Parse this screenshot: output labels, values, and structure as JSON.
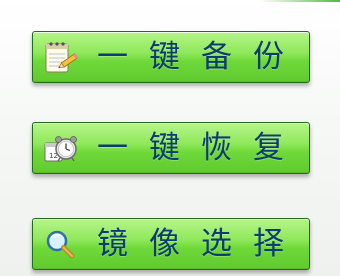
{
  "buttons": {
    "backup": {
      "label": "一键备份",
      "icon": "notepad-pencil-icon"
    },
    "restore": {
      "label": "一键恢复",
      "icon": "alarm-clock-calendar-icon"
    },
    "select_image": {
      "label": "镜像选择",
      "icon": "magnifier-icon"
    }
  },
  "colors": {
    "button_green": "#7ee24a",
    "button_border": "#1f6f17",
    "label_text": "#0c3d6e"
  }
}
